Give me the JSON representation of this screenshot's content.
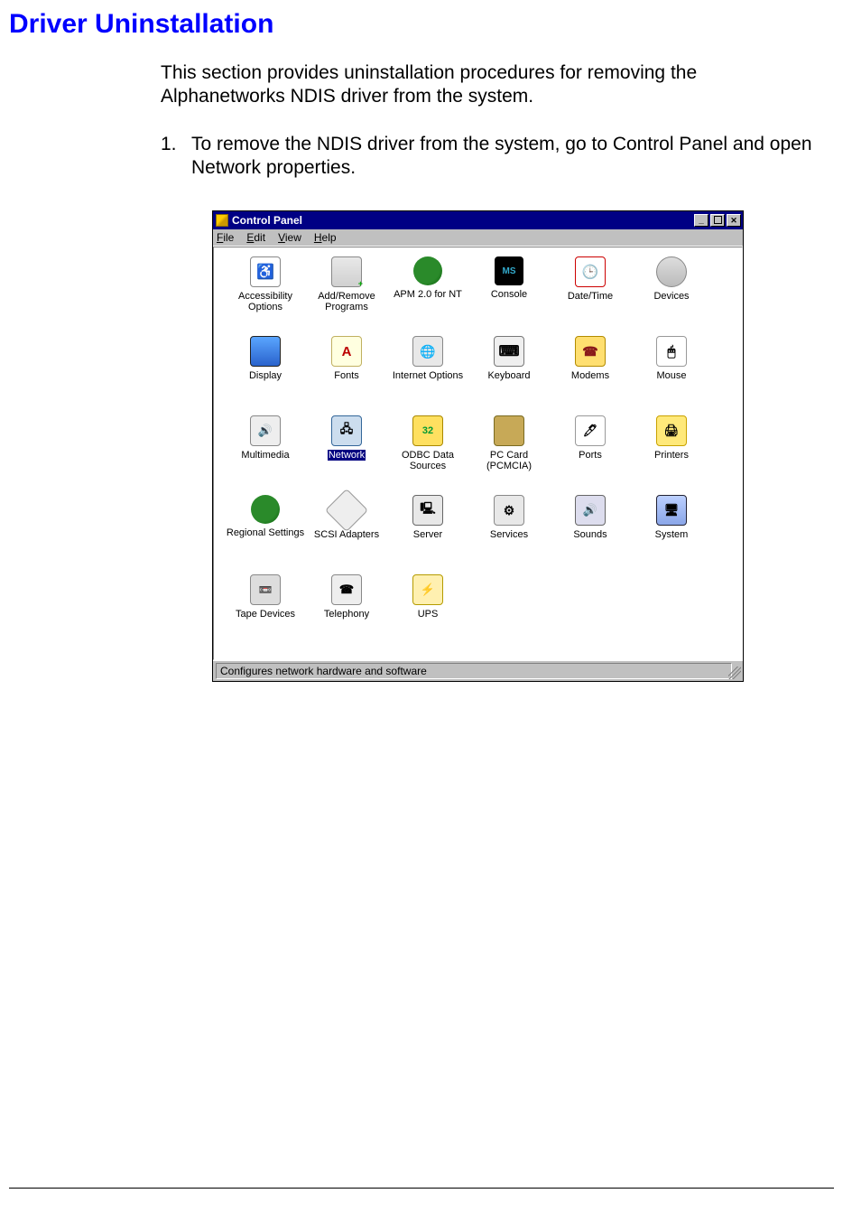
{
  "heading": "Driver Uninstallation",
  "intro": "This section provides uninstallation procedures for removing the Alphanetworks NDIS driver from the system.",
  "step": {
    "num": "1.",
    "text": "To remove the NDIS driver from the system, go to Control Panel and open Network properties."
  },
  "window": {
    "title": "Control Panel",
    "menu": [
      "File",
      "Edit",
      "View",
      "Help"
    ],
    "status": "Configures network hardware and software",
    "items": [
      {
        "label": "Accessibility Options",
        "iconClass": "ico-access",
        "selected": false
      },
      {
        "label": "Add/Remove Programs",
        "iconClass": "ico-addremove",
        "selected": false
      },
      {
        "label": "APM 2.0 for NT",
        "iconClass": "ico-apm",
        "selected": false
      },
      {
        "label": "Console",
        "iconClass": "ico-console",
        "selected": false
      },
      {
        "label": "Date/Time",
        "iconClass": "ico-datetime",
        "selected": false
      },
      {
        "label": "Devices",
        "iconClass": "ico-devices",
        "selected": false
      },
      {
        "label": "Display",
        "iconClass": "ico-display",
        "selected": false
      },
      {
        "label": "Fonts",
        "iconClass": "ico-fonts",
        "selected": false
      },
      {
        "label": "Internet Options",
        "iconClass": "ico-inet",
        "selected": false
      },
      {
        "label": "Keyboard",
        "iconClass": "ico-keyboard",
        "selected": false
      },
      {
        "label": "Modems",
        "iconClass": "ico-modems",
        "selected": false
      },
      {
        "label": "Mouse",
        "iconClass": "ico-mouse",
        "selected": false
      },
      {
        "label": "Multimedia",
        "iconClass": "ico-mm",
        "selected": false
      },
      {
        "label": "Network",
        "iconClass": "ico-network",
        "selected": true
      },
      {
        "label": "ODBC Data Sources",
        "iconClass": "ico-odbc",
        "selected": false
      },
      {
        "label": "PC Card (PCMCIA)",
        "iconClass": "ico-pccard",
        "selected": false
      },
      {
        "label": "Ports",
        "iconClass": "ico-ports",
        "selected": false
      },
      {
        "label": "Printers",
        "iconClass": "ico-printers",
        "selected": false
      },
      {
        "label": "Regional Settings",
        "iconClass": "ico-regional",
        "selected": false
      },
      {
        "label": "SCSI Adapters",
        "iconClass": "ico-scsi",
        "selected": false
      },
      {
        "label": "Server",
        "iconClass": "ico-server",
        "selected": false
      },
      {
        "label": "Services",
        "iconClass": "ico-services",
        "selected": false
      },
      {
        "label": "Sounds",
        "iconClass": "ico-sounds",
        "selected": false
      },
      {
        "label": "System",
        "iconClass": "ico-system",
        "selected": false
      },
      {
        "label": "Tape Devices",
        "iconClass": "ico-tape",
        "selected": false
      },
      {
        "label": "Telephony",
        "iconClass": "ico-tel",
        "selected": false
      },
      {
        "label": "UPS",
        "iconClass": "ico-ups",
        "selected": false
      }
    ]
  }
}
